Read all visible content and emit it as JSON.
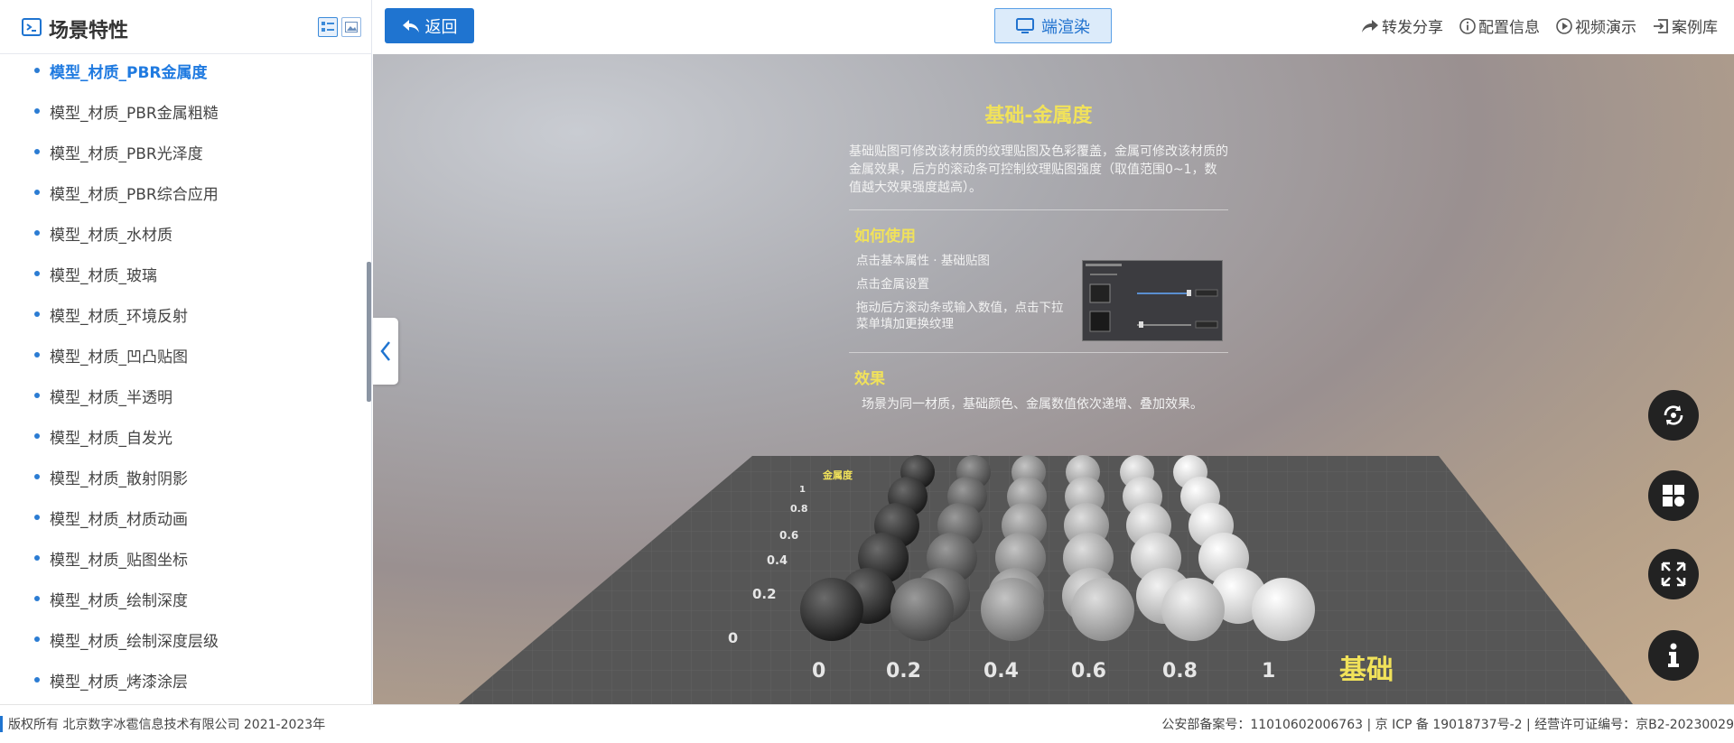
{
  "sidebar": {
    "title": "场景特性",
    "items": [
      {
        "label": "模型_材质_PBR金属度",
        "active": true
      },
      {
        "label": "模型_材质_PBR金属粗糙"
      },
      {
        "label": "模型_材质_PBR光泽度"
      },
      {
        "label": "模型_材质_PBR综合应用"
      },
      {
        "label": "模型_材质_水材质"
      },
      {
        "label": "模型_材质_玻璃"
      },
      {
        "label": "模型_材质_环境反射"
      },
      {
        "label": "模型_材质_凹凸贴图"
      },
      {
        "label": "模型_材质_半透明"
      },
      {
        "label": "模型_材质_自发光"
      },
      {
        "label": "模型_材质_散射阴影"
      },
      {
        "label": "模型_材质_材质动画"
      },
      {
        "label": "模型_材质_贴图坐标"
      },
      {
        "label": "模型_材质_绘制深度"
      },
      {
        "label": "模型_材质_绘制深度层级"
      },
      {
        "label": "模型_材质_烤漆涂层"
      }
    ]
  },
  "topbar": {
    "back_label": "返回",
    "render_label": "端渲染",
    "actions": [
      "转发分享",
      "配置信息",
      "视频演示",
      "案例库"
    ]
  },
  "scene": {
    "title": "基础-金属度",
    "description": "基础贴图可修改该材质的纹理贴图及色彩覆盖，金属可修改该材质的金属效果，后方的滚动条可控制纹理贴图强度（取值范围0~1，数值越大效果强度越高）。",
    "howto_heading": "如何使用",
    "steps": [
      "点击基本属性 · 基础贴图",
      "点击金属设置",
      "拖动后方滚动条或输入数值，点击下拉菜单填加更换纹理"
    ],
    "effect_heading": "效果",
    "effect_text": "场景为同一材质，基础颜色、金属数值依次递增、叠加效果。",
    "x_axis_label": "基础",
    "x_ticks": [
      "0",
      "0.2",
      "0.4",
      "0.6",
      "0.8",
      "1"
    ],
    "y_ticks": [
      "0",
      "0.2",
      "0.4",
      "0.6",
      "0.8",
      "1"
    ],
    "y_axis_label": "金属度"
  },
  "footer": {
    "copyright": "版权所有 北京数字冰雹信息技术有限公司 2021-2023年",
    "license": "公安部备案号：11010602006763 | 京 ICP 备 19018737号-2 | 经营许可证编号：京B2-20230029"
  }
}
